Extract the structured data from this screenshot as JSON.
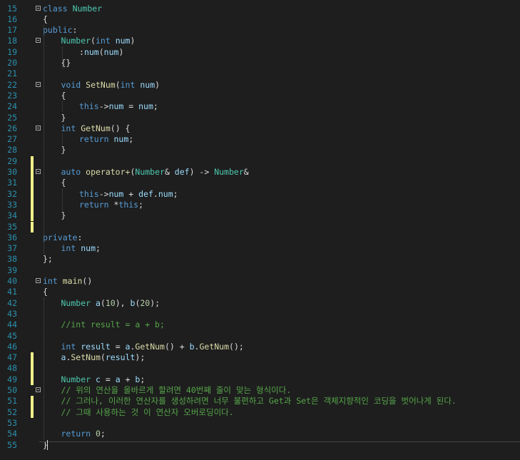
{
  "editor": {
    "lines": [
      {
        "n": "15",
        "fold": true,
        "changed": false,
        "indent": 0,
        "tokens": [
          [
            "kw",
            "class"
          ],
          [
            "p",
            " "
          ],
          [
            "ty",
            "Number"
          ]
        ]
      },
      {
        "n": "16",
        "fold": false,
        "changed": false,
        "indent": 0,
        "tokens": [
          [
            "p",
            "{"
          ]
        ]
      },
      {
        "n": "17",
        "fold": false,
        "changed": false,
        "indent": 0,
        "tokens": [
          [
            "kw",
            "public"
          ],
          [
            "p",
            ":"
          ]
        ]
      },
      {
        "n": "18",
        "fold": true,
        "changed": false,
        "indent": 1,
        "tokens": [
          [
            "ty",
            "Number"
          ],
          [
            "p",
            "("
          ],
          [
            "kw",
            "int"
          ],
          [
            "p",
            " "
          ],
          [
            "var",
            "num"
          ],
          [
            "p",
            ")"
          ]
        ]
      },
      {
        "n": "19",
        "fold": false,
        "changed": false,
        "indent": 2,
        "tokens": [
          [
            "p",
            ":"
          ],
          [
            "var",
            "num"
          ],
          [
            "p",
            "("
          ],
          [
            "var",
            "num"
          ],
          [
            "p",
            ")"
          ]
        ]
      },
      {
        "n": "20",
        "fold": false,
        "changed": false,
        "indent": 1,
        "tokens": [
          [
            "p",
            "{}"
          ]
        ]
      },
      {
        "n": "21",
        "fold": false,
        "changed": false,
        "indent": 0,
        "tokens": []
      },
      {
        "n": "22",
        "fold": true,
        "changed": false,
        "indent": 1,
        "tokens": [
          [
            "kw",
            "void"
          ],
          [
            "p",
            " "
          ],
          [
            "fn",
            "SetNum"
          ],
          [
            "p",
            "("
          ],
          [
            "kw",
            "int"
          ],
          [
            "p",
            " "
          ],
          [
            "var",
            "num"
          ],
          [
            "p",
            ")"
          ]
        ]
      },
      {
        "n": "23",
        "fold": false,
        "changed": false,
        "indent": 1,
        "tokens": [
          [
            "p",
            "{"
          ]
        ]
      },
      {
        "n": "24",
        "fold": false,
        "changed": false,
        "indent": 2,
        "tokens": [
          [
            "kw",
            "this"
          ],
          [
            "p",
            "->"
          ],
          [
            "var",
            "num"
          ],
          [
            "p",
            " = "
          ],
          [
            "var",
            "num"
          ],
          [
            "p",
            ";"
          ]
        ]
      },
      {
        "n": "25",
        "fold": false,
        "changed": false,
        "indent": 1,
        "tokens": [
          [
            "p",
            "}"
          ]
        ]
      },
      {
        "n": "26",
        "fold": true,
        "changed": false,
        "indent": 1,
        "tokens": [
          [
            "kw",
            "int"
          ],
          [
            "p",
            " "
          ],
          [
            "fn",
            "GetNum"
          ],
          [
            "p",
            "() {"
          ]
        ]
      },
      {
        "n": "27",
        "fold": false,
        "changed": false,
        "indent": 2,
        "tokens": [
          [
            "kw",
            "return"
          ],
          [
            "p",
            " "
          ],
          [
            "var",
            "num"
          ],
          [
            "p",
            ";"
          ]
        ]
      },
      {
        "n": "28",
        "fold": false,
        "changed": false,
        "indent": 1,
        "tokens": [
          [
            "p",
            "}"
          ]
        ]
      },
      {
        "n": "29",
        "fold": false,
        "changed": true,
        "indent": 0,
        "tokens": []
      },
      {
        "n": "30",
        "fold": true,
        "changed": true,
        "indent": 1,
        "tokens": [
          [
            "kw",
            "auto"
          ],
          [
            "p",
            " "
          ],
          [
            "fn",
            "operator+"
          ],
          [
            "p",
            "("
          ],
          [
            "ty",
            "Number"
          ],
          [
            "p",
            "& "
          ],
          [
            "var",
            "def"
          ],
          [
            "p",
            ") -> "
          ],
          [
            "ty",
            "Number"
          ],
          [
            "p",
            "&"
          ]
        ]
      },
      {
        "n": "31",
        "fold": false,
        "changed": true,
        "indent": 1,
        "tokens": [
          [
            "p",
            "{"
          ]
        ]
      },
      {
        "n": "32",
        "fold": false,
        "changed": true,
        "indent": 2,
        "tokens": [
          [
            "kw",
            "this"
          ],
          [
            "p",
            "->"
          ],
          [
            "var",
            "num"
          ],
          [
            "p",
            " + "
          ],
          [
            "var",
            "def"
          ],
          [
            "p",
            "."
          ],
          [
            "var",
            "num"
          ],
          [
            "p",
            ";"
          ]
        ]
      },
      {
        "n": "33",
        "fold": false,
        "changed": true,
        "indent": 2,
        "tokens": [
          [
            "kw",
            "return"
          ],
          [
            "p",
            " *"
          ],
          [
            "kw",
            "this"
          ],
          [
            "p",
            ";"
          ]
        ]
      },
      {
        "n": "34",
        "fold": false,
        "changed": true,
        "indent": 1,
        "tokens": [
          [
            "p",
            "}"
          ]
        ]
      },
      {
        "n": "35",
        "fold": false,
        "changed": true,
        "indent": 0,
        "tokens": []
      },
      {
        "n": "36",
        "fold": false,
        "changed": false,
        "indent": 0,
        "tokens": [
          [
            "kw",
            "private"
          ],
          [
            "p",
            ":"
          ]
        ]
      },
      {
        "n": "37",
        "fold": false,
        "changed": false,
        "indent": 1,
        "tokens": [
          [
            "kw",
            "int"
          ],
          [
            "p",
            " "
          ],
          [
            "var",
            "num"
          ],
          [
            "p",
            ";"
          ]
        ]
      },
      {
        "n": "38",
        "fold": false,
        "changed": false,
        "indent": 0,
        "tokens": [
          [
            "p",
            "};"
          ]
        ]
      },
      {
        "n": "39",
        "fold": false,
        "changed": false,
        "indent": 0,
        "tokens": []
      },
      {
        "n": "40",
        "fold": true,
        "changed": false,
        "indent": 0,
        "tokens": [
          [
            "kw",
            "int"
          ],
          [
            "p",
            " "
          ],
          [
            "fn",
            "main"
          ],
          [
            "p",
            "()"
          ]
        ]
      },
      {
        "n": "41",
        "fold": false,
        "changed": false,
        "indent": 0,
        "tokens": [
          [
            "p",
            "{"
          ]
        ]
      },
      {
        "n": "42",
        "fold": false,
        "changed": false,
        "indent": 1,
        "tokens": [
          [
            "ty",
            "Number"
          ],
          [
            "p",
            " "
          ],
          [
            "var",
            "a"
          ],
          [
            "p",
            "("
          ],
          [
            "num",
            "10"
          ],
          [
            "p",
            "), "
          ],
          [
            "var",
            "b"
          ],
          [
            "p",
            "("
          ],
          [
            "num",
            "20"
          ],
          [
            "p",
            ");"
          ]
        ]
      },
      {
        "n": "43",
        "fold": false,
        "changed": false,
        "indent": 0,
        "tokens": []
      },
      {
        "n": "44",
        "fold": false,
        "changed": false,
        "indent": 1,
        "tokens": [
          [
            "cm",
            "//int result = a + b;"
          ]
        ]
      },
      {
        "n": "45",
        "fold": false,
        "changed": false,
        "indent": 0,
        "tokens": []
      },
      {
        "n": "46",
        "fold": false,
        "changed": false,
        "indent": 1,
        "tokens": [
          [
            "kw",
            "int"
          ],
          [
            "p",
            " "
          ],
          [
            "var",
            "result"
          ],
          [
            "p",
            " = "
          ],
          [
            "var",
            "a"
          ],
          [
            "p",
            "."
          ],
          [
            "fn",
            "GetNum"
          ],
          [
            "p",
            "() + "
          ],
          [
            "var",
            "b"
          ],
          [
            "p",
            "."
          ],
          [
            "fn",
            "GetNum"
          ],
          [
            "p",
            "();"
          ]
        ]
      },
      {
        "n": "47",
        "fold": false,
        "changed": true,
        "indent": 1,
        "tokens": [
          [
            "var",
            "a"
          ],
          [
            "p",
            "."
          ],
          [
            "fn",
            "SetNum"
          ],
          [
            "p",
            "("
          ],
          [
            "var",
            "result"
          ],
          [
            "p",
            ");"
          ]
        ]
      },
      {
        "n": "48",
        "fold": false,
        "changed": true,
        "indent": 0,
        "tokens": []
      },
      {
        "n": "49",
        "fold": false,
        "changed": true,
        "indent": 1,
        "tokens": [
          [
            "ty",
            "Number"
          ],
          [
            "p",
            " "
          ],
          [
            "var",
            "c"
          ],
          [
            "p",
            " = "
          ],
          [
            "var",
            "a"
          ],
          [
            "p",
            " + "
          ],
          [
            "var",
            "b"
          ],
          [
            "p",
            ";"
          ]
        ]
      },
      {
        "n": "50",
        "fold": true,
        "changed": false,
        "indent": 1,
        "tokens": [
          [
            "cm",
            "// 위의 연산을 올바르게 할려면 40번째 줄이 맞는 형식이다."
          ]
        ]
      },
      {
        "n": "51",
        "fold": false,
        "changed": true,
        "indent": 1,
        "tokens": [
          [
            "cm",
            "// 그러나, 이러한 연산자를 생성하려면 너무 불편하고 Get과 Set은 객체지향적인 코딩을 벗어나게 된다."
          ]
        ]
      },
      {
        "n": "52",
        "fold": false,
        "changed": true,
        "indent": 1,
        "tokens": [
          [
            "cm",
            "// 그때 사용하는 것 이 연산자 오버로딩이다."
          ]
        ]
      },
      {
        "n": "53",
        "fold": false,
        "changed": false,
        "indent": 0,
        "tokens": []
      },
      {
        "n": "54",
        "fold": false,
        "changed": false,
        "indent": 1,
        "tokens": [
          [
            "kw",
            "return"
          ],
          [
            "p",
            " "
          ],
          [
            "num",
            "0"
          ],
          [
            "p",
            ";"
          ]
        ]
      },
      {
        "n": "55",
        "fold": false,
        "changed": false,
        "indent": 0,
        "tokens": [
          [
            "p",
            "}"
          ]
        ]
      }
    ]
  }
}
